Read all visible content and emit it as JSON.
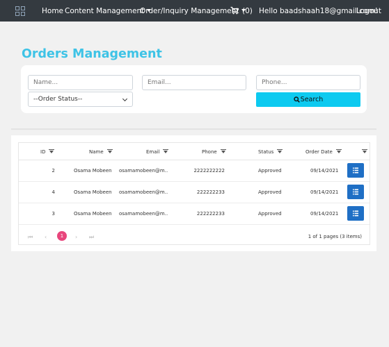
{
  "navbar": {
    "logo": "grid-logo-icon",
    "home": "Home",
    "content_management": "Content Management",
    "orders_menu": "Order/Inquiry Management",
    "cart_icon": "cart-icon",
    "cart_count": "(0)",
    "greeting": "Hello baadshaah18@gmail.com!",
    "logout": "Logout"
  },
  "page": {
    "title": "Orders Management"
  },
  "search": {
    "name_placeholder": "Name...",
    "email_placeholder": "Email...",
    "phone_placeholder": "Phone...",
    "status_selected": "--Order Status--",
    "search_label": "Search"
  },
  "grid": {
    "headers": {
      "id": "ID",
      "name": "Name",
      "email": "Email",
      "phone": "Phone",
      "status": "Status",
      "order_date": "Order Date"
    },
    "rows": [
      {
        "id": "2",
        "name": "Osama Mobeen",
        "email": "osamamobeen@m...",
        "phone": "2222222222",
        "status": "Approved",
        "order_date": "09/14/2021"
      },
      {
        "id": "4",
        "name": "Osama Mobeen",
        "email": "osamamobeen@m...",
        "phone": "222222233",
        "status": "Approved",
        "order_date": "09/14/2021"
      },
      {
        "id": "3",
        "name": "Osama Mobeen",
        "email": "osamamobeen@m...",
        "phone": "222222233",
        "status": "Approved",
        "order_date": "09/14/2021"
      }
    ],
    "pager": {
      "first": "⏮",
      "prev": "‹",
      "current_page": "1",
      "next": "›",
      "last": "⏭",
      "info": "1 of 1 pages (3 items)"
    }
  },
  "colors": {
    "navbar": "#343a40",
    "title": "#3ec3e6",
    "search_button": "#0dcaf0",
    "edit_button": "#1f6fc5",
    "active_page": "#e8467c"
  }
}
